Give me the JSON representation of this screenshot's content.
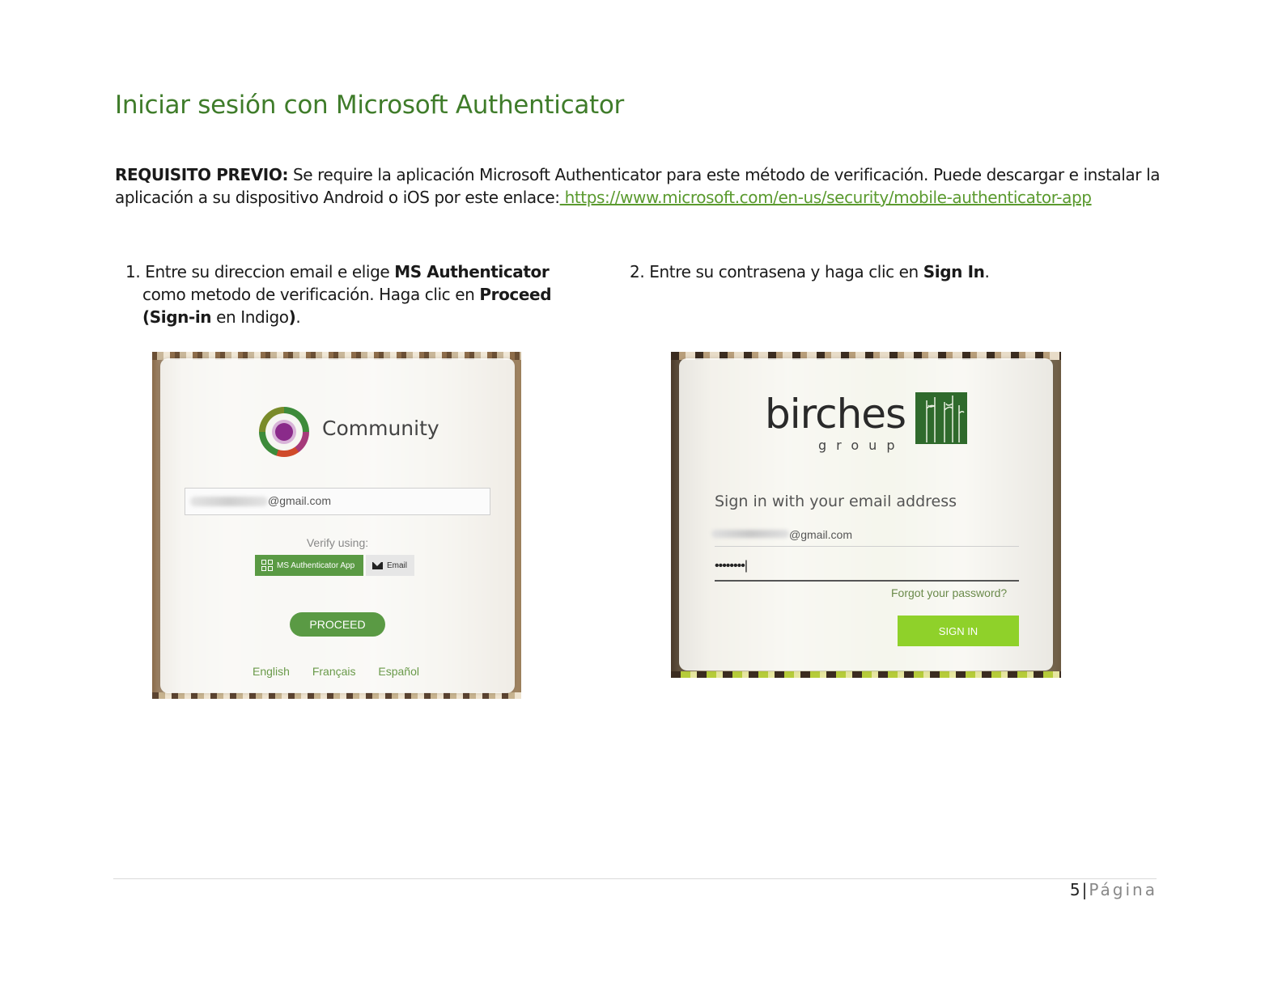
{
  "title": "Iniciar sesión con Microsoft Authenticator",
  "prereq": {
    "label": "REQUISITO PREVIO:",
    "text": " Se require la aplicación Microsoft Authenticator para este método de verificación. Puede descargar e instalar la aplicación a su dispositivo Android o iOS por este enlace:",
    "link": " https://www.microsoft.com/en-us/security/mobile-authenticator-app"
  },
  "step1": {
    "number": "1.",
    "part1": "Entre su direccion email e elige ",
    "bold1": "MS Authenticator",
    "part2": " como metodo de verificación. Haga clic en ",
    "bold2": "Proceed",
    "bold3": "(Sign-in",
    "part3": " en Indigo",
    "bold4": ")",
    "end": "."
  },
  "step2": {
    "number": "2.",
    "part1": "Entre su contrasena y haga clic en ",
    "bold1": "Sign In",
    "end": "."
  },
  "screenshot1": {
    "brand": "Community",
    "email_suffix": "@gmail.com",
    "verify_label": "Verify using:",
    "ms_button": "MS Authenticator App",
    "email_button": "Email",
    "proceed_button": "PROCEED",
    "languages": [
      "English",
      "Français",
      "Español"
    ]
  },
  "screenshot2": {
    "brand": "birches",
    "brand_sub": "group",
    "heading": "Sign in with your email address",
    "email_suffix": "@gmail.com",
    "password_mask": "••••••••|",
    "forgot_link": "Forgot your password?",
    "signin_button": "SIGN IN"
  },
  "footer": {
    "page_number": "5",
    "separator": "|",
    "page_label": "Página"
  }
}
